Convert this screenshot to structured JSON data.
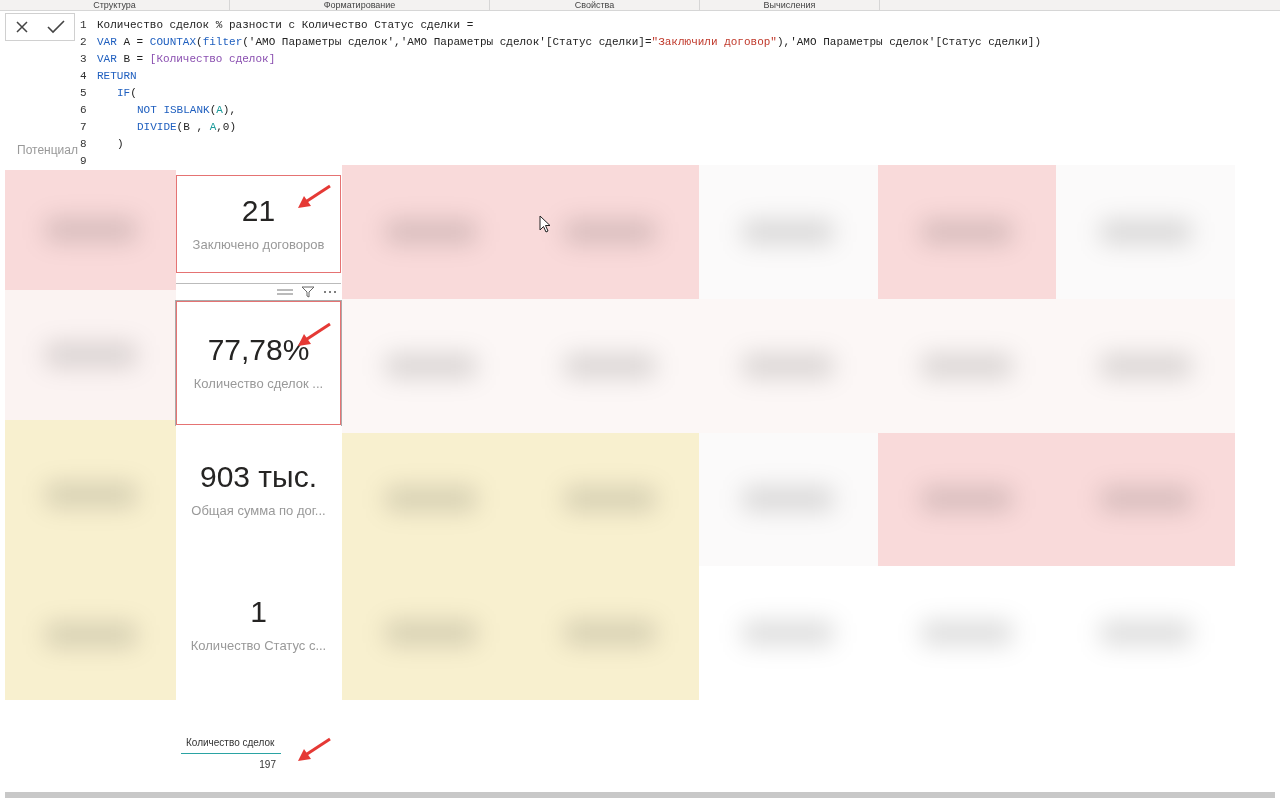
{
  "ribbon_groups": [
    "Структура",
    "Форматирование",
    "Свойства",
    "Вычисления"
  ],
  "formula_bar": {
    "lines": [
      {
        "number": "1",
        "tokens": [
          {
            "kind": "plain",
            "text": "Количество сделок % разности с Количество Статус сделки ="
          }
        ]
      },
      {
        "number": "2",
        "tokens": [
          {
            "kind": "keyword",
            "text": "VAR"
          },
          {
            "kind": "plain",
            "text": " A = "
          },
          {
            "kind": "keyword",
            "text": "COUNTAX"
          },
          {
            "kind": "plain",
            "text": "("
          },
          {
            "kind": "keyword",
            "text": "filter"
          },
          {
            "kind": "plain",
            "text": "('АМО Параметры сделок','АМО Параметры сделок'[Статус сделки]="
          },
          {
            "kind": "string",
            "text": "\"Заключили договор\""
          },
          {
            "kind": "plain",
            "text": "),'АМО Параметры сделок'[Статус сделки])"
          }
        ]
      },
      {
        "number": "3",
        "tokens": [
          {
            "kind": "keyword",
            "text": "VAR"
          },
          {
            "kind": "plain",
            "text": " B = "
          },
          {
            "kind": "measure",
            "text": "[Количество сделок]"
          }
        ]
      },
      {
        "number": "4",
        "tokens": [
          {
            "kind": "keyword",
            "text": "RETURN"
          }
        ],
        "children": [
          {
            "number": "5",
            "tokens": [
              {
                "kind": "keyword",
                "text": "IF"
              },
              {
                "kind": "plain",
                "text": "("
              }
            ],
            "children": [
              {
                "number": "6",
                "tokens": [
                  {
                    "kind": "keyword",
                    "text": "NOT ISBLANK"
                  },
                  {
                    "kind": "plain",
                    "text": "("
                  },
                  {
                    "kind": "variable",
                    "text": "A"
                  },
                  {
                    "kind": "plain",
                    "text": "),"
                  }
                ]
              },
              {
                "number": "7",
                "tokens": [
                  {
                    "kind": "keyword",
                    "text": "DIVIDE"
                  },
                  {
                    "kind": "plain",
                    "text": "(B , "
                  },
                  {
                    "kind": "variable",
                    "text": "A"
                  },
                  {
                    "kind": "plain",
                    "text": ",0)"
                  }
                ]
              }
            ]
          },
          {
            "number": "8",
            "tokens": [
              {
                "kind": "plain",
                "text": ")"
              }
            ]
          }
        ]
      },
      {
        "number": "9"
      }
    ],
    "hidden_label": "Потенциал"
  },
  "cards": [
    {
      "value": "21",
      "label": "Заключено договоров",
      "outlined": true,
      "focused": false,
      "arrow": true
    },
    {
      "value": "77,78%",
      "label": "Количество сделок ...",
      "outlined": true,
      "focused": true,
      "arrow": true
    },
    {
      "value": "903 тыс.",
      "label": "Общая сумма по дог...",
      "outlined": false,
      "focused": false,
      "arrow": false
    },
    {
      "value": "1",
      "label": "Количество Статус с...",
      "outlined": false,
      "focused": false,
      "arrow": false
    }
  ],
  "table": {
    "header": "Количество сделок",
    "value": "197",
    "arrow": true
  },
  "left_tiles": [
    {
      "color": "#f9dada"
    },
    {
      "color": "#fbf3f2"
    },
    {
      "color": "#f8f0cf"
    },
    {
      "color": "#f8f0cf"
    }
  ],
  "grid_tiles": [
    {
      "color": "#f9dada"
    },
    {
      "color": "#f9dada"
    },
    {
      "color": "#fbfafa"
    },
    {
      "color": "#f9dada"
    },
    {
      "color": "#fbfafa"
    },
    {
      "color": "#fcf7f6"
    },
    {
      "color": "#fcf7f6"
    },
    {
      "color": "#fcf7f6"
    },
    {
      "color": "#fcf7f6"
    },
    {
      "color": "#fcf7f6"
    },
    {
      "color": "#f8f0cf"
    },
    {
      "color": "#f8f0cf"
    },
    {
      "color": "#fbfafa"
    },
    {
      "color": "#f9dada"
    },
    {
      "color": "#f9dada"
    },
    {
      "color": "#f8f0cf"
    },
    {
      "color": "#f8f0cf"
    },
    {
      "color": "#ffffff"
    },
    {
      "color": "#ffffff"
    },
    {
      "color": "#ffffff"
    }
  ]
}
